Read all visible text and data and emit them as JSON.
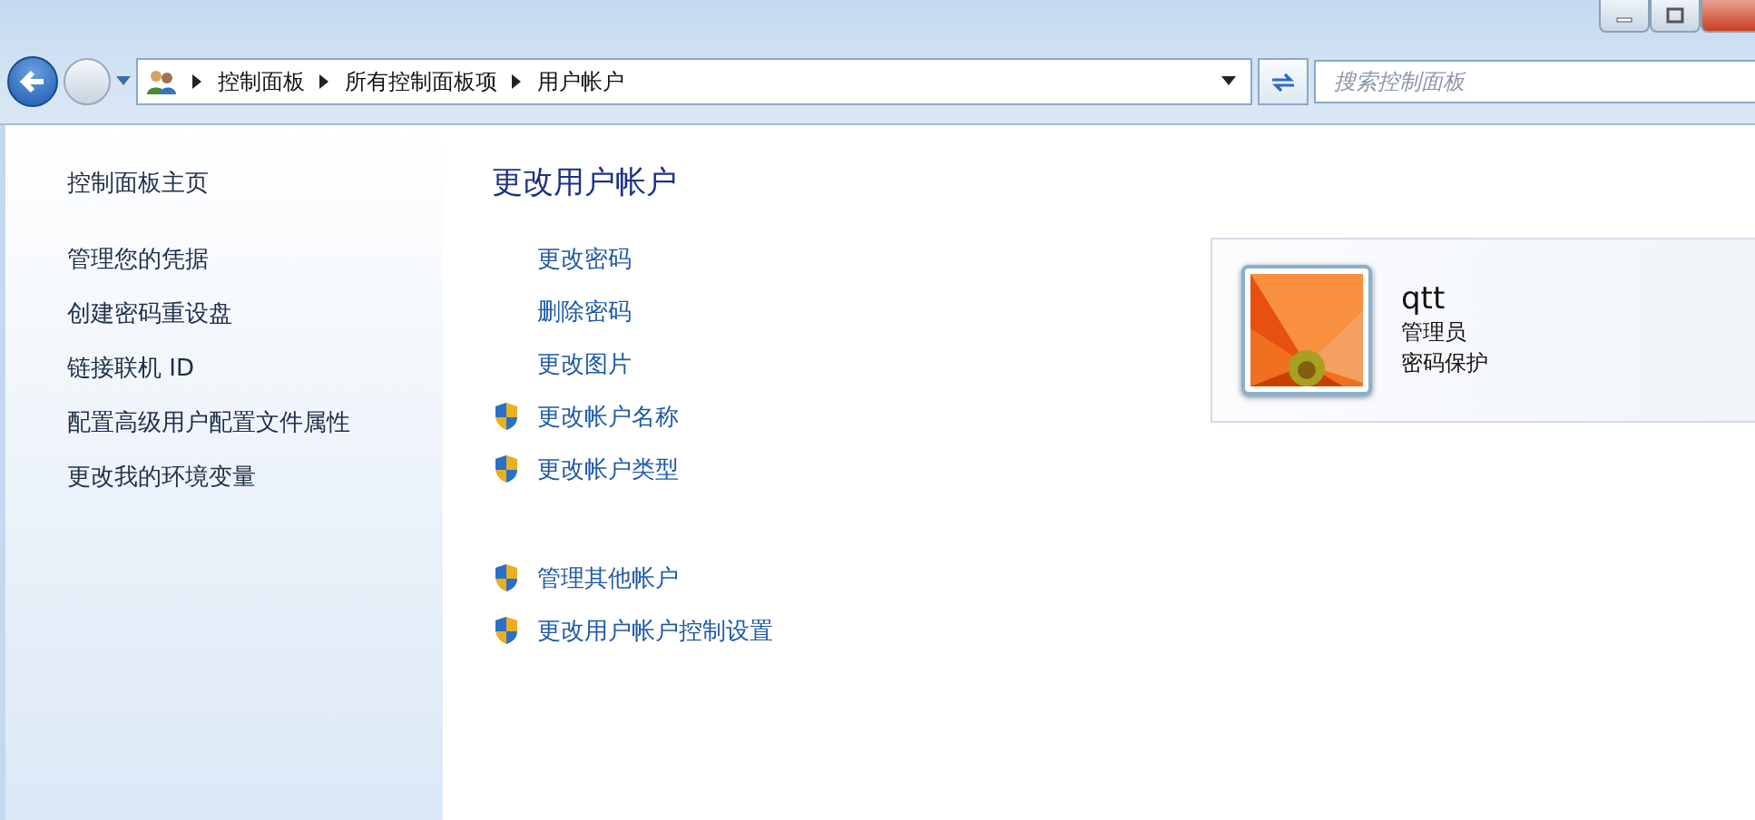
{
  "address_bar": {
    "breadcrumbs": [
      "控制面板",
      "所有控制面板项",
      "用户帐户"
    ]
  },
  "search": {
    "placeholder": "搜索控制面板"
  },
  "sidebar": {
    "items": [
      {
        "label": "控制面板主页",
        "kind": "home"
      },
      {
        "label": "管理您的凭据",
        "kind": "link"
      },
      {
        "label": "创建密码重设盘",
        "kind": "link"
      },
      {
        "label": "链接联机 ID",
        "kind": "link"
      },
      {
        "label": "配置高级用户配置文件属性",
        "kind": "link"
      },
      {
        "label": "更改我的环境变量",
        "kind": "link"
      }
    ]
  },
  "main": {
    "heading": "更改用户帐户",
    "tasks": [
      {
        "label": "更改密码",
        "kind": "link"
      },
      {
        "label": "删除密码",
        "kind": "link"
      },
      {
        "label": "更改图片",
        "kind": "link"
      },
      {
        "label": "更改帐户名称",
        "kind": "shield"
      },
      {
        "label": "更改帐户类型",
        "kind": "shield"
      }
    ],
    "other_tasks": [
      {
        "label": "管理其他帐户",
        "kind": "shield"
      },
      {
        "label": "更改用户帐户控制设置",
        "kind": "shield"
      }
    ]
  },
  "account": {
    "name": "qtt",
    "role": "管理员",
    "status": "密码保护"
  }
}
